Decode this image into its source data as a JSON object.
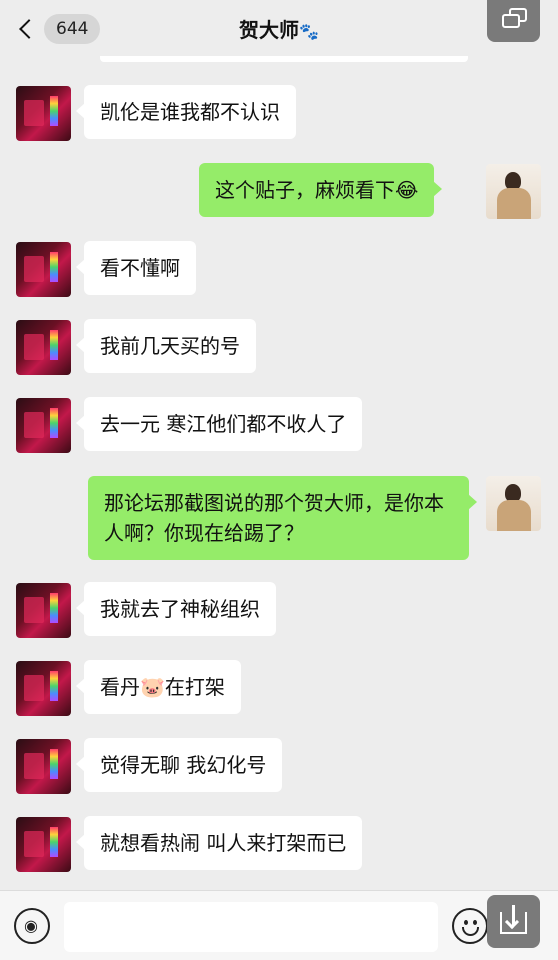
{
  "header": {
    "back_count": "644",
    "title": "贺大师",
    "title_icon": "🐾"
  },
  "messages": [
    {
      "side": "in",
      "text": "凯伦是谁我都不认识"
    },
    {
      "side": "out",
      "text": "这个贴子，麻烦看下",
      "emoji": "😂"
    },
    {
      "side": "in",
      "text": "看不懂啊"
    },
    {
      "side": "in",
      "text": "我前几天买的号"
    },
    {
      "side": "in",
      "text": "去一元 寒江他们都不收人了"
    },
    {
      "side": "out",
      "text": "那论坛那截图说的那个贺大师，是你本人啊？你现在给踢了？"
    },
    {
      "side": "in",
      "text": "我就去了神秘组织"
    },
    {
      "side": "in",
      "text_a": "看丹",
      "emoji": "🐷",
      "text_b": "在打架"
    },
    {
      "side": "in",
      "text": "觉得无聊 我幻化号"
    },
    {
      "side": "in",
      "text": "就想看热闹 叫人来打架而已"
    }
  ],
  "input": {
    "value": "",
    "placeholder": ""
  },
  "colors": {
    "background": "#ededed",
    "outgoing_bubble": "#95ec69",
    "incoming_bubble": "#ffffff",
    "overlay_button": "#7a7a7a"
  },
  "icons": {
    "back": "chevron-left-icon",
    "window": "window-icon",
    "voice": "voice-icon",
    "emoji": "emoji-icon",
    "download": "download-icon"
  }
}
